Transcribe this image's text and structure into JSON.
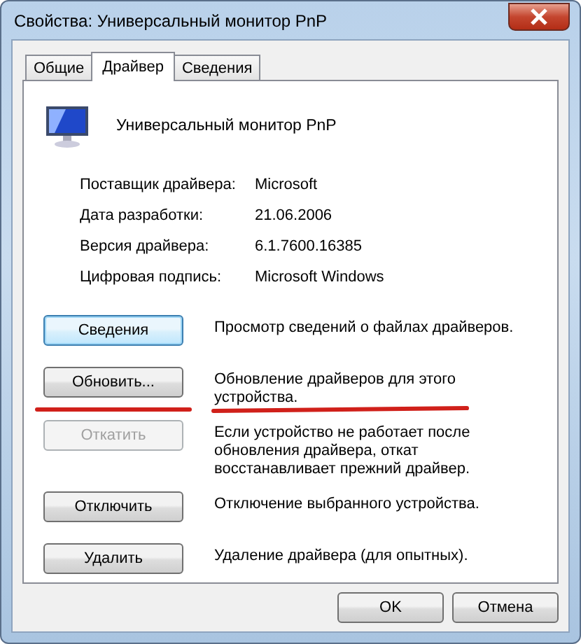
{
  "window": {
    "title": "Свойства: Универсальный монитор PnP"
  },
  "tabs": [
    {
      "label": "Общие",
      "selected": false
    },
    {
      "label": "Драйвер",
      "selected": true
    },
    {
      "label": "Сведения",
      "selected": false
    }
  ],
  "device": {
    "name": "Универсальный монитор PnP"
  },
  "properties": [
    {
      "label": "Поставщик драйвера:",
      "value": "Microsoft"
    },
    {
      "label": "Дата разработки:",
      "value": "21.06.2006"
    },
    {
      "label": "Версия драйвера:",
      "value": "6.1.7600.16385"
    },
    {
      "label": "Цифровая подпись:",
      "value": "Microsoft Windows"
    }
  ],
  "actions": [
    {
      "button": "Сведения",
      "description": "Просмотр сведений о файлах драйверов.",
      "disabled": false,
      "focused": true,
      "underlined": false
    },
    {
      "button": "Обновить...",
      "description": "Обновление драйверов для этого устройства.",
      "disabled": false,
      "focused": false,
      "underlined": true
    },
    {
      "button": "Откатить",
      "description": "Если устройство не работает после обновления драйвера, откат восстанавливает прежний драйвер.",
      "disabled": true,
      "focused": false,
      "underlined": false
    },
    {
      "button": "Отключить",
      "description": "Отключение выбранного устройства.",
      "disabled": false,
      "focused": false,
      "underlined": false
    },
    {
      "button": "Удалить",
      "description": "Удаление драйвера (для опытных).",
      "disabled": false,
      "focused": false,
      "underlined": false
    }
  ],
  "footer_buttons": [
    "OK",
    "Отмена"
  ]
}
